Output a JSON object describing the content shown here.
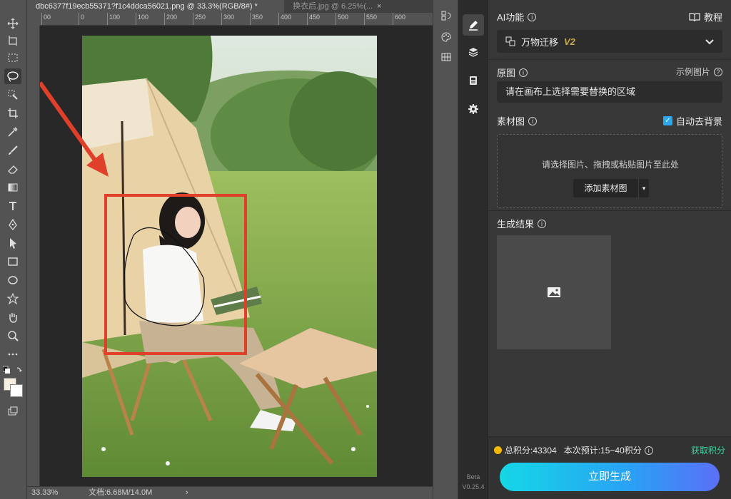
{
  "tabs": [
    {
      "label": "dbc6377f19ecb55371?f1c4ddca56021.png @ 33.3%(RGB/8#) *",
      "close": "×"
    },
    {
      "label": "换衣后.jpg @ 6.25%(...",
      "close": "×"
    }
  ],
  "ruler": {
    "ticks": [
      "00",
      "0",
      "100",
      "100",
      "200",
      "250",
      "300",
      "350",
      "400",
      "450",
      "500",
      "550",
      "600",
      "650"
    ]
  },
  "status": {
    "zoom": "33.33%",
    "doc": "文档:6.68M/14.0M",
    "arrow": "›"
  },
  "tools": [
    "move-tool",
    "artboard-tool",
    "marquee-tool",
    "lasso-tool",
    "quick-select-tool",
    "crop-tool",
    "eyedropper-tool",
    "brush-tool",
    "eraser-tool",
    "gradient-tool",
    "type-tool",
    "pen-tool",
    "path-select-tool",
    "rectangle-tool",
    "ellipse-tool",
    "custom-shape-tool",
    "hand-tool",
    "zoom-tool",
    "more-tools"
  ],
  "plugin": {
    "beta": "Beta",
    "version": "V0.25.4",
    "ai_section": {
      "label": "AI功能",
      "tutorial": "教程",
      "selected": "万物迁移",
      "badge": "V2"
    },
    "original": {
      "label": "原图",
      "example": "示例图片",
      "field": "请在画布上选择需要替换的区域"
    },
    "material": {
      "label": "素材图",
      "auto_bg": "自动去背景",
      "hint": "请选择图片、拖拽或粘贴图片至此处",
      "add_button": "添加素材图"
    },
    "result": {
      "label": "生成结果"
    },
    "footer": {
      "total_points": "总积分:43304",
      "estimate": "本次预计:15~40积分",
      "get_points": "获取积分",
      "generate": "立即生成"
    }
  },
  "colors": {
    "accent_red": "#e0402a",
    "gradient_start": "#15d7e6",
    "gradient_end": "#5b6ff7",
    "coin": "#f5b800",
    "link_green": "#3ad4a0"
  }
}
